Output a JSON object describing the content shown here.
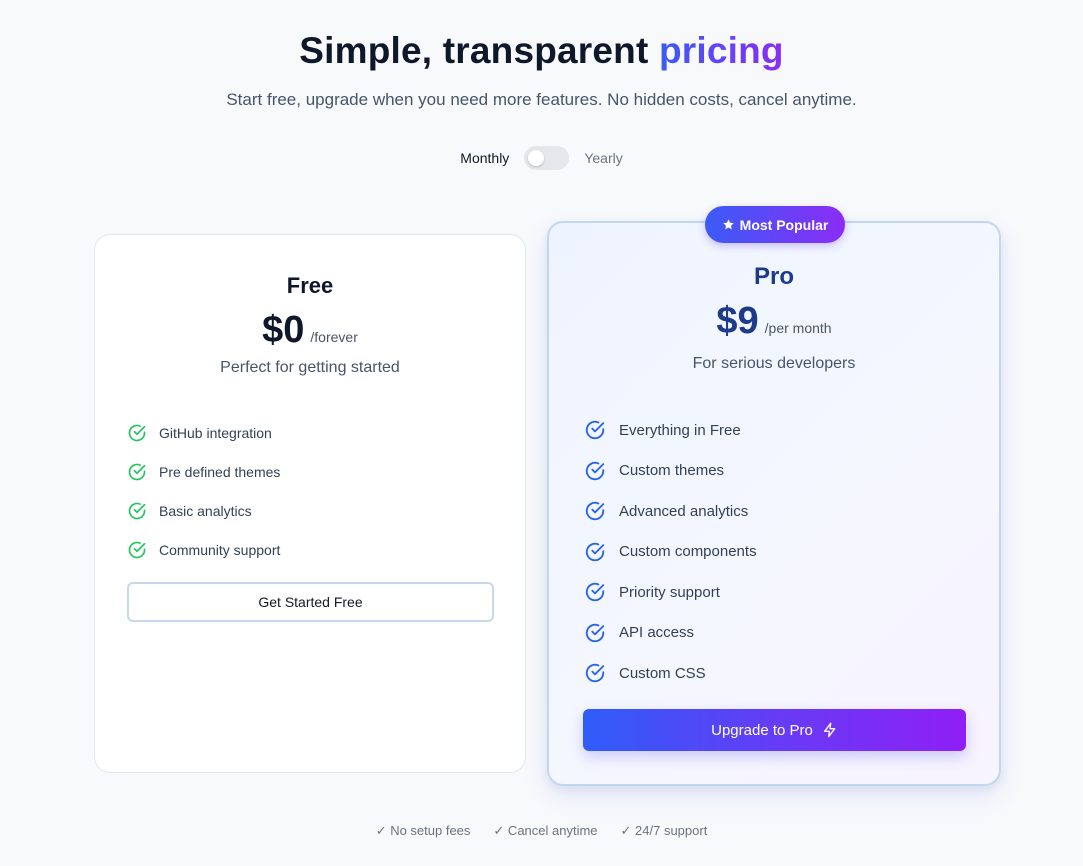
{
  "header": {
    "title_main": "Simple, transparent",
    "title_accent": "pricing",
    "subtitle": "Start free, upgrade when you need more features. No hidden costs, cancel anytime."
  },
  "billing": {
    "monthly_label": "Monthly",
    "yearly_label": "Yearly",
    "yearly_selected": false
  },
  "plans": {
    "free": {
      "name": "Free",
      "price": "$0",
      "period": "/forever",
      "tagline": "Perfect for getting started",
      "features": [
        "GitHub integration",
        "Pre defined themes",
        "Basic analytics",
        "Community support"
      ],
      "button_label": "Get Started Free",
      "check_color": "#22c55e"
    },
    "pro": {
      "badge": "Most Popular",
      "badge_icon": "star-icon",
      "name": "Pro",
      "price": "$9",
      "period": "/per month",
      "tagline": "For serious developers",
      "features": [
        "Everything in Free",
        "Custom themes",
        "Advanced analytics",
        "Custom components",
        "Priority support",
        "API access",
        "Custom CSS"
      ],
      "button_label": "Upgrade to Pro",
      "button_icon": "lightning-icon",
      "check_color": "#2563eb"
    }
  },
  "footer": {
    "notes": [
      "✓ No setup fees",
      "✓ Cancel anytime",
      "✓ 24/7 support"
    ]
  },
  "colors": {
    "accent_start": "#3b5bf6",
    "accent_end": "#8b2cf5",
    "pro_text": "#1e3a8a"
  }
}
